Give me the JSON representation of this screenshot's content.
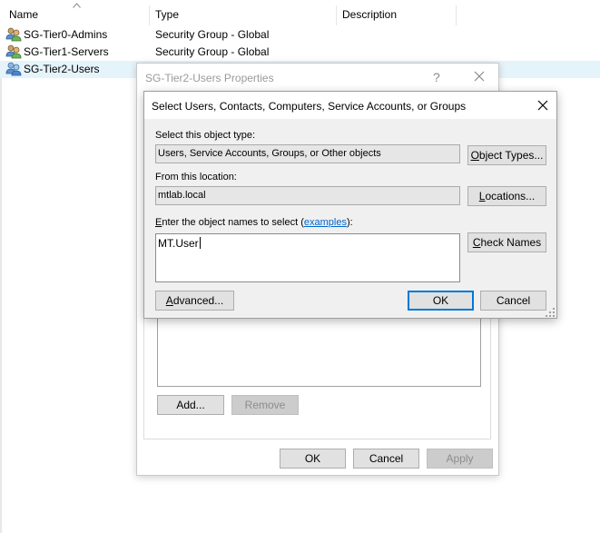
{
  "list": {
    "columns": {
      "name": "Name",
      "type": "Type",
      "description": "Description"
    },
    "rows": [
      {
        "name": "SG-Tier0-Admins",
        "type": "Security Group - Global",
        "selected": false
      },
      {
        "name": "SG-Tier1-Servers",
        "type": "Security Group - Global",
        "selected": false
      },
      {
        "name": "SG-Tier2-Users",
        "type": "",
        "selected": true
      }
    ]
  },
  "properties_dialog": {
    "title": "SG-Tier2-Users Properties",
    "help": "?",
    "add_label": "Add...",
    "remove_label": "Remove",
    "ok_label": "OK",
    "cancel_label": "Cancel",
    "apply_label": "Apply"
  },
  "select_dialog": {
    "title": "Select Users, Contacts, Computers, Service Accounts, or Groups",
    "object_type_label": "Select this object type:",
    "object_type_value": "Users, Service Accounts, Groups, or Other objects",
    "object_types_button_pre": "",
    "object_types_button_ul": "O",
    "object_types_button_post": "bject Types...",
    "location_label": "From this location:",
    "location_value": "mtlab.local",
    "locations_button_pre": "",
    "locations_button_ul": "L",
    "locations_button_post": "ocations...",
    "enter_label_pre": "",
    "enter_label_ul": "E",
    "enter_label_mid": "nter the object names to select (",
    "examples_link": "examples",
    "enter_label_post": "):",
    "names_value": "MT.User",
    "check_names_pre": "",
    "check_names_ul": "C",
    "check_names_post": "heck Names",
    "advanced_pre": "",
    "advanced_ul": "A",
    "advanced_post": "dvanced...",
    "ok_label": "OK",
    "cancel_label": "Cancel"
  },
  "colors": {
    "selection": "#e5f3fb",
    "default_button_border": "#0078d7",
    "link": "#0066cc"
  }
}
